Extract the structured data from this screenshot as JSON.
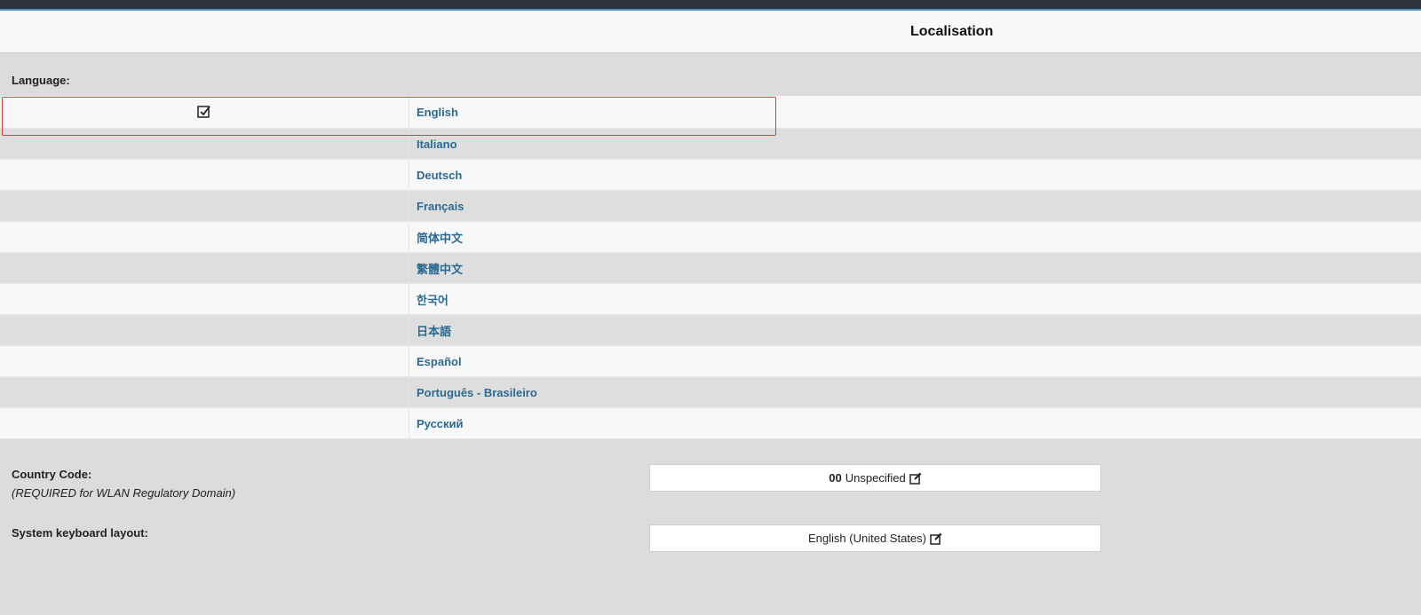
{
  "header": {
    "title": "Localisation"
  },
  "language": {
    "label": "Language:",
    "items": [
      {
        "name": "English",
        "selected": true
      },
      {
        "name": "Italiano",
        "selected": false
      },
      {
        "name": "Deutsch",
        "selected": false
      },
      {
        "name": "Français",
        "selected": false
      },
      {
        "name": "简体中文",
        "selected": false
      },
      {
        "name": "繁體中文",
        "selected": false
      },
      {
        "name": "한국어",
        "selected": false
      },
      {
        "name": "日本語",
        "selected": false
      },
      {
        "name": "Español",
        "selected": false
      },
      {
        "name": "Português - Brasileiro",
        "selected": false
      },
      {
        "name": "Русский",
        "selected": false
      }
    ]
  },
  "country": {
    "label": "Country Code:",
    "sublabel": "(REQUIRED for WLAN Regulatory Domain)",
    "code": "00",
    "value": "Unspecified"
  },
  "keyboard": {
    "label": "System keyboard layout:",
    "value": "English (United States)"
  },
  "colors": {
    "link": "#2a6a93",
    "highlight": "#d9443f",
    "topbar": "#2e3339"
  },
  "icons": {
    "selected": "checked-box-icon",
    "edit": "edit-icon"
  }
}
